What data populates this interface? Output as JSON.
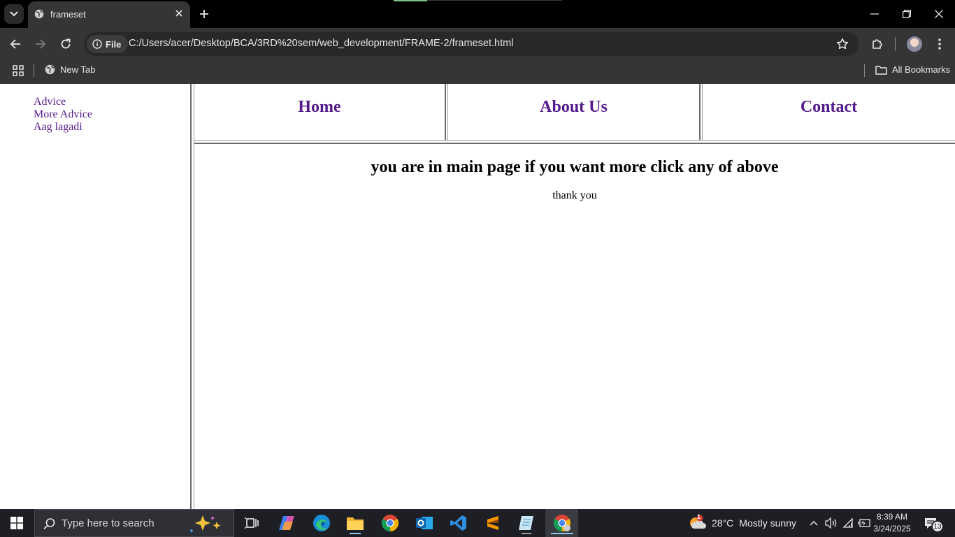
{
  "browser": {
    "tab_title": "frameset",
    "address_chip": "File",
    "url": "C:/Users/acer/Desktop/BCA/3RD%20sem/web_development/FRAME-2/frameset.html",
    "bookmarks": {
      "new_tab": "New Tab",
      "all_bookmarks": "All Bookmarks"
    }
  },
  "page": {
    "left_links": [
      "Advice",
      "More Advice",
      "Aag lagadi"
    ],
    "top_links": [
      "Home",
      "About Us",
      "Contact"
    ],
    "main_heading": "you are in main page if you want more click any of above",
    "main_text": "thank you",
    "link_color": "#551a8b"
  },
  "taskbar": {
    "search_placeholder": "Type here to search",
    "weather_temp": "28°C",
    "weather_desc": "Mostly sunny",
    "weather_badge": "1",
    "time": "8:39 AM",
    "date": "3/24/2025",
    "notification_count": "13"
  }
}
